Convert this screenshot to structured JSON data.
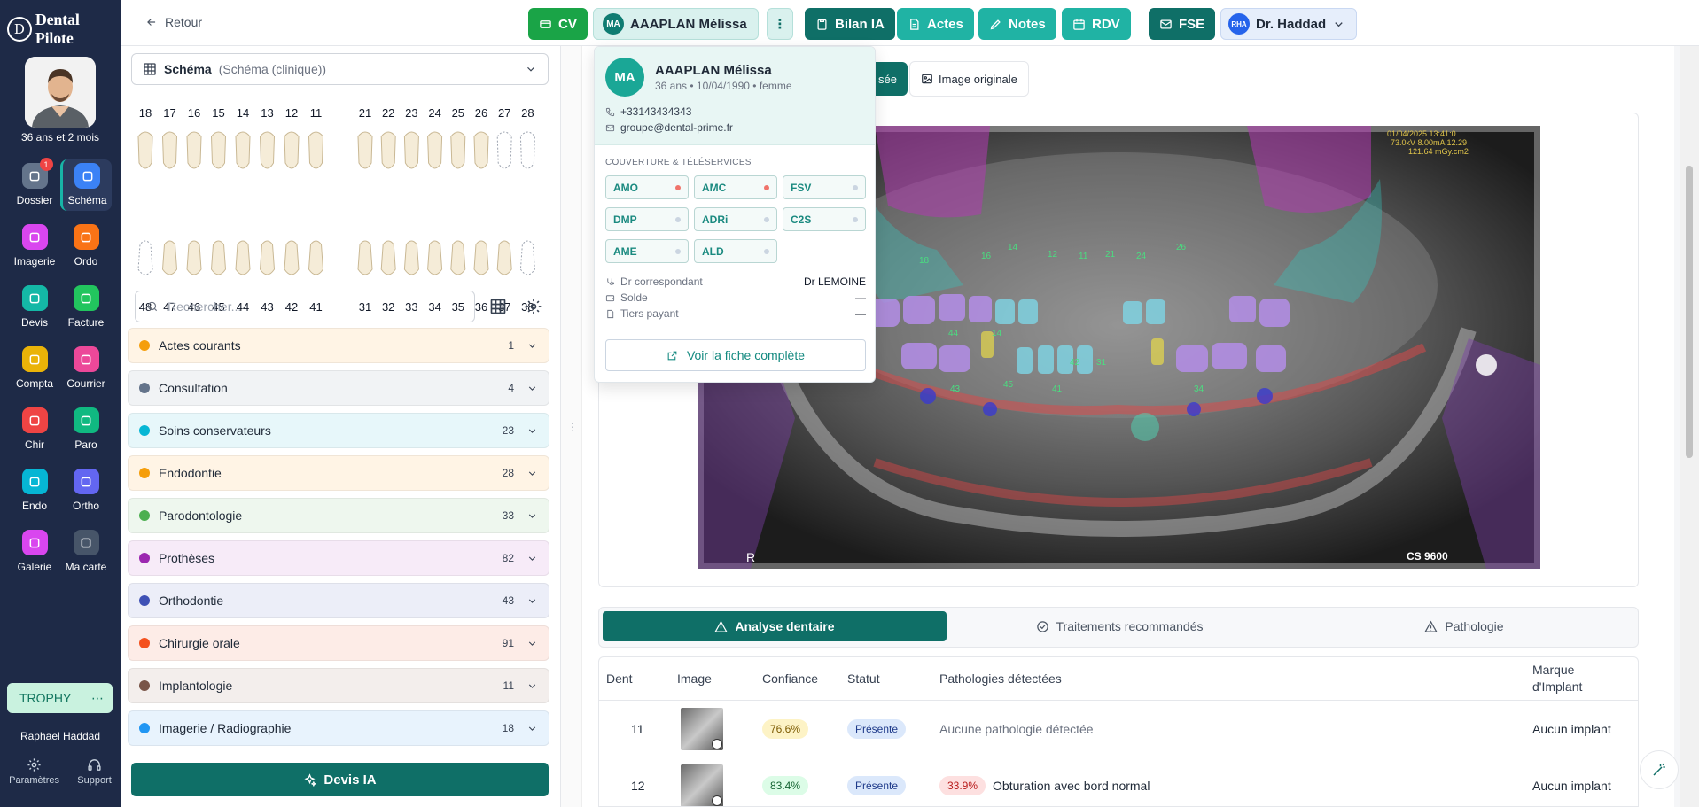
{
  "brand": {
    "logo_letter": "D",
    "name": "Dental Pilote"
  },
  "doctor": {
    "age": "36 ans et 2 mois",
    "user_name": "Raphael Haddad"
  },
  "nav": {
    "items": [
      {
        "label": "Dossier",
        "icon": "folder-icon",
        "color": "#64748b",
        "badge": "1"
      },
      {
        "label": "Schéma",
        "icon": "stethoscope-icon",
        "color": "#3b82f6"
      },
      {
        "label": "Imagerie",
        "icon": "camera-icon",
        "color": "#d946ef"
      },
      {
        "label": "Ordo",
        "icon": "pill-icon",
        "color": "#f97316"
      },
      {
        "label": "Devis",
        "icon": "quote-icon",
        "color": "#14b8a6"
      },
      {
        "label": "Facture",
        "icon": "invoice-icon",
        "color": "#22c55e"
      },
      {
        "label": "Compta",
        "icon": "calculator-icon",
        "color": "#eab308"
      },
      {
        "label": "Courrier",
        "icon": "mail-icon",
        "color": "#ec4899"
      },
      {
        "label": "Chir",
        "icon": "scissors-icon",
        "color": "#ef4444"
      },
      {
        "label": "Paro",
        "icon": "waves-icon",
        "color": "#10b981"
      },
      {
        "label": "Endo",
        "icon": "tooth-root-icon",
        "color": "#06b6d4"
      },
      {
        "label": "Ortho",
        "icon": "ortho-icon",
        "color": "#6366f1"
      },
      {
        "label": "Galerie",
        "icon": "gallery-icon",
        "color": "#d946ef"
      },
      {
        "label": "Ma carte",
        "icon": "card-icon",
        "color": "#475569"
      }
    ],
    "trophy": "TROPHY",
    "bottom": [
      {
        "label": "Paramètres",
        "icon": "gear-icon"
      },
      {
        "label": "Support",
        "icon": "headset-icon"
      }
    ]
  },
  "topbar": {
    "back": "Retour",
    "cv": "CV",
    "patient_initials": "MA",
    "patient_name": "AAAPLAN Mélissa",
    "bilan": "Bilan IA",
    "actes": "Actes",
    "notes": "Notes",
    "rdv": "RDV",
    "fse": "FSE",
    "doctor_initials": "RHA",
    "doctor_name": "Dr. Haddad",
    "colors": {
      "cv": "#16a34a",
      "dark": "#0f6f67",
      "teal": "#20b3a4"
    }
  },
  "popover": {
    "initials": "MA",
    "name": "AAAPLAN Mélissa",
    "sub": "36 ans • 10/04/1990 • femme",
    "phone": "+33143434343",
    "email": "groupe@dental-prime.fr",
    "coverage_title": "COUVERTURE & TÉLÉSERVICES",
    "coverage": [
      {
        "label": "AMO",
        "status": "red"
      },
      {
        "label": "AMC",
        "status": "red"
      },
      {
        "label": "FSV",
        "status": "grey"
      },
      {
        "label": "DMP",
        "status": "grey"
      },
      {
        "label": "ADRi",
        "status": "grey"
      },
      {
        "label": "C2S",
        "status": "grey"
      },
      {
        "label": "AME",
        "status": "grey"
      },
      {
        "label": "ALD",
        "status": "grey"
      }
    ],
    "correspondant_label": "Dr correspondant",
    "correspondant_value": "Dr LEMOINE",
    "solde_label": "Solde",
    "solde_value": "—",
    "tiers_label": "Tiers payant",
    "tiers_value": "—",
    "full_sheet": "Voir la fiche complète"
  },
  "schema": {
    "select_label": "Schéma",
    "select_sub": "(Schéma (clinique))",
    "upper_teeth": [
      "18",
      "17",
      "16",
      "15",
      "14",
      "13",
      "12",
      "11",
      "21",
      "22",
      "23",
      "24",
      "25",
      "26",
      "27",
      "28"
    ],
    "lower_teeth": [
      "48",
      "47",
      "46",
      "45",
      "44",
      "43",
      "42",
      "41",
      "31",
      "32",
      "33",
      "34",
      "35",
      "36",
      "37",
      "38"
    ],
    "search_placeholder": "Rechercher...",
    "categories": [
      {
        "label": "Actes courants",
        "count": "1",
        "color": "#f59e0b",
        "bg": "#fff4e5"
      },
      {
        "label": "Consultation",
        "count": "4",
        "color": "#64748b",
        "bg": "#f1f3f5"
      },
      {
        "label": "Soins conservateurs",
        "count": "23",
        "color": "#06b6d4",
        "bg": "#e7f7fa"
      },
      {
        "label": "Endodontie",
        "count": "28",
        "color": "#f59e0b",
        "bg": "#fff4e5"
      },
      {
        "label": "Parodontologie",
        "count": "33",
        "color": "#4caf50",
        "bg": "#eef7ee"
      },
      {
        "label": "Prothèses",
        "count": "82",
        "color": "#9c27b0",
        "bg": "#f7ebf8"
      },
      {
        "label": "Orthodontie",
        "count": "43",
        "color": "#3f51b5",
        "bg": "#eceef8"
      },
      {
        "label": "Chirurgie orale",
        "count": "91",
        "color": "#f4511e",
        "bg": "#fdece7"
      },
      {
        "label": "Implantologie",
        "count": "11",
        "color": "#795548",
        "bg": "#f3eeec"
      },
      {
        "label": "Imagerie / Radiographie",
        "count": "18",
        "color": "#2196f3",
        "bg": "#e8f3fd"
      }
    ],
    "devis_ia": "Devis IA"
  },
  "main": {
    "view_tab_active": "sée",
    "view_tab_original": "Image originale",
    "xray_text": {
      "date": "01/04/2025 13:41:0",
      "params1": "73.0kV 8.00mA 12.29",
      "params2": "121.64 mGy.cm2",
      "model": "CS 9600",
      "side": "R"
    },
    "analysis_tabs": [
      "Analyse dentaire",
      "Traitements recommandés",
      "Pathologie"
    ],
    "table_headers": [
      "Dent",
      "Image",
      "Confiance",
      "Statut",
      "Pathologies détectées",
      "Marque d'Implant"
    ],
    "rows": [
      {
        "dent": "11",
        "confidence": "76.6%",
        "status": "Présente",
        "patho_pct": "",
        "pathology": "Aucune pathologie détectée",
        "implant": "Aucun implant"
      },
      {
        "dent": "12",
        "confidence": "83.4%",
        "status": "Présente",
        "patho_pct": "33.9%",
        "pathology": "Obturation avec bord normal",
        "implant": "Aucun implant"
      }
    ]
  }
}
